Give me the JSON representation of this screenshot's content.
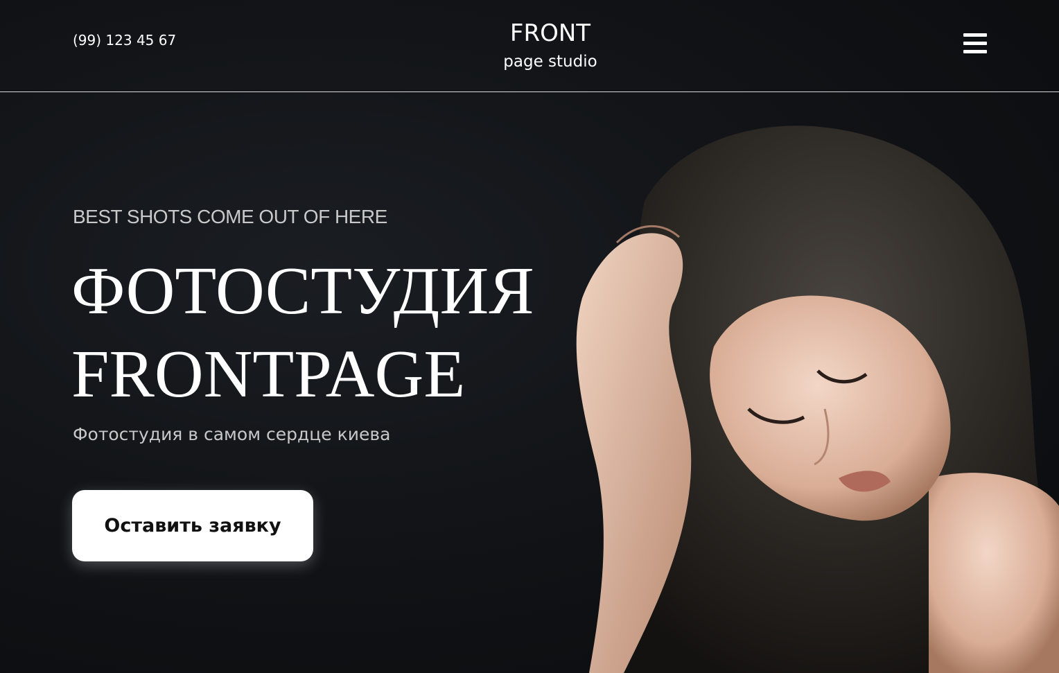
{
  "header": {
    "phone": "(99) 123 45 67",
    "logo_main": "FRONT",
    "logo_sub": "page studio",
    "menu_icon": "hamburger-menu-icon"
  },
  "hero": {
    "eyebrow": "BEST SHOTS COME OUT OF HERE",
    "title_line1": "ФОТОСТУДИЯ",
    "title_line2": "FRONTPAGE",
    "subtitle": "Фотостудия в самом сердце киева",
    "cta_label": "Оставить заявку",
    "photo": "portrait-photo"
  },
  "colors": {
    "background": "#0d0f12",
    "text": "#ffffff",
    "muted": "#c8c8c8",
    "button_bg": "#ffffff",
    "button_text": "#111111"
  }
}
